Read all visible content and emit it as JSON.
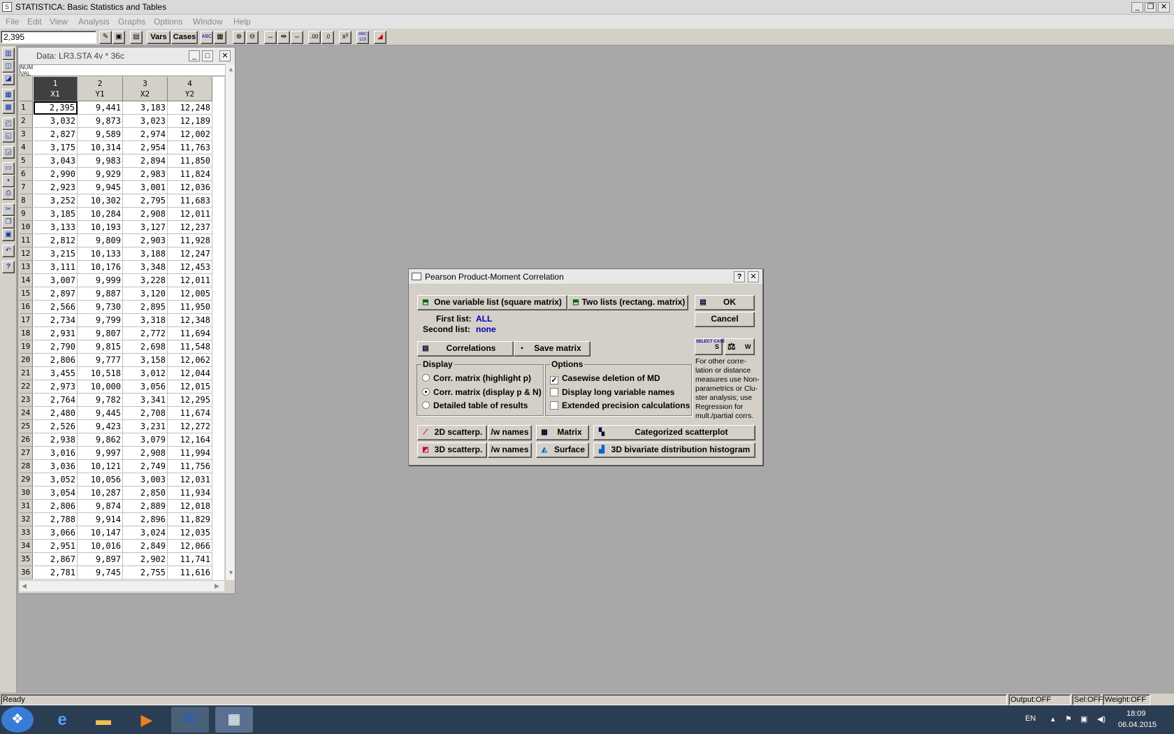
{
  "window": {
    "title": "STATISTICA: Basic Statistics and Tables",
    "controls": [
      "_",
      "❐",
      "✕"
    ]
  },
  "menu": [
    "File",
    "Edit",
    "View",
    "Analysis",
    "Graphs",
    "Options",
    "Window",
    "Help"
  ],
  "toolbar": {
    "value": "2,395",
    "vars_label": "Vars",
    "cases_label": "Cases",
    "abc_label": "ABC",
    "x2_label": "x²",
    "abc123_label": "ABC 123"
  },
  "datawin": {
    "title": "Data: LR3.STA 4v * 36c",
    "info_line1": "NUM",
    "info_line2": "VAL",
    "columns": [
      {
        "num": "1",
        "name": "X1"
      },
      {
        "num": "2",
        "name": "Y1"
      },
      {
        "num": "3",
        "name": "X2"
      },
      {
        "num": "4",
        "name": "Y2"
      }
    ],
    "rows": [
      [
        "2,395",
        "9,441",
        "3,183",
        "12,248"
      ],
      [
        "3,032",
        "9,873",
        "3,023",
        "12,189"
      ],
      [
        "2,827",
        "9,589",
        "2,974",
        "12,002"
      ],
      [
        "3,175",
        "10,314",
        "2,954",
        "11,763"
      ],
      [
        "3,043",
        "9,983",
        "2,894",
        "11,850"
      ],
      [
        "2,990",
        "9,929",
        "2,983",
        "11,824"
      ],
      [
        "2,923",
        "9,945",
        "3,001",
        "12,036"
      ],
      [
        "3,252",
        "10,302",
        "2,795",
        "11,683"
      ],
      [
        "3,185",
        "10,284",
        "2,908",
        "12,011"
      ],
      [
        "3,133",
        "10,193",
        "3,127",
        "12,237"
      ],
      [
        "2,812",
        "9,809",
        "2,903",
        "11,928"
      ],
      [
        "3,215",
        "10,133",
        "3,188",
        "12,247"
      ],
      [
        "3,111",
        "10,176",
        "3,348",
        "12,453"
      ],
      [
        "3,007",
        "9,999",
        "3,228",
        "12,011"
      ],
      [
        "2,897",
        "9,887",
        "3,120",
        "12,005"
      ],
      [
        "2,566",
        "9,730",
        "2,895",
        "11,950"
      ],
      [
        "2,734",
        "9,799",
        "3,318",
        "12,348"
      ],
      [
        "2,931",
        "9,807",
        "2,772",
        "11,694"
      ],
      [
        "2,790",
        "9,815",
        "2,698",
        "11,548"
      ],
      [
        "2,806",
        "9,777",
        "3,158",
        "12,062"
      ],
      [
        "3,455",
        "10,518",
        "3,012",
        "12,044"
      ],
      [
        "2,973",
        "10,000",
        "3,056",
        "12,015"
      ],
      [
        "2,764",
        "9,782",
        "3,341",
        "12,295"
      ],
      [
        "2,480",
        "9,445",
        "2,708",
        "11,674"
      ],
      [
        "2,526",
        "9,423",
        "3,231",
        "12,272"
      ],
      [
        "2,938",
        "9,862",
        "3,079",
        "12,164"
      ],
      [
        "3,016",
        "9,997",
        "2,908",
        "11,994"
      ],
      [
        "3,036",
        "10,121",
        "2,749",
        "11,756"
      ],
      [
        "3,052",
        "10,056",
        "3,003",
        "12,031"
      ],
      [
        "3,054",
        "10,287",
        "2,850",
        "11,934"
      ],
      [
        "2,806",
        "9,874",
        "2,889",
        "12,018"
      ],
      [
        "2,788",
        "9,914",
        "2,896",
        "11,829"
      ],
      [
        "3,066",
        "10,147",
        "3,024",
        "12,035"
      ],
      [
        "2,951",
        "10,016",
        "2,849",
        "12,066"
      ],
      [
        "2,867",
        "9,897",
        "2,902",
        "11,741"
      ],
      [
        "2,781",
        "9,745",
        "2,755",
        "11,616"
      ]
    ]
  },
  "dialog": {
    "title": "Pearson Product-Moment Correlation",
    "help": "?",
    "close": "✕",
    "one_list": "One variable list (square matrix)",
    "two_lists": "Two lists (rectang. matrix)",
    "ok": "OK",
    "cancel": "Cancel",
    "first_list_label": "First list:",
    "first_list_value": "ALL",
    "second_list_label": "Second list:",
    "second_list_value": "none",
    "correlations": "Correlations",
    "save_matrix": "Save matrix",
    "select_cases": "SELECT CASES",
    "s_label": "S",
    "w_label": "W",
    "display_legend": "Display",
    "display_options": [
      {
        "label": "Corr. matrix (highlight p)",
        "selected": false
      },
      {
        "label": "Corr. matrix (display p & N)",
        "selected": true
      },
      {
        "label": "Detailed table of results",
        "selected": false
      }
    ],
    "options_legend": "Options",
    "options": [
      {
        "label": "Casewise deletion of MD",
        "checked": true
      },
      {
        "label": "Display long variable names",
        "checked": false
      },
      {
        "label": "Extended precision calculations",
        "checked": false
      }
    ],
    "note": "For other corre- lation or distance measures use Non- parametrics or Clu- ster analysis; use Regression for mult./partial corrs.",
    "scatter2d": "2D scatterp.",
    "names1": "/w names",
    "matrix": "Matrix",
    "categorized": "Categorized scatterplot",
    "scatter3d": "3D scatterp.",
    "names2": "/w names",
    "surface": "Surface",
    "bivariate": "3D bivariate distribution histogram"
  },
  "status": {
    "ready": "Ready",
    "output": "Output:OFF",
    "sel": "Sel:OFF",
    "weight": "Weight:OFF"
  },
  "tray": {
    "lang": "EN",
    "time": "18:09",
    "date": "06.04.2015"
  }
}
